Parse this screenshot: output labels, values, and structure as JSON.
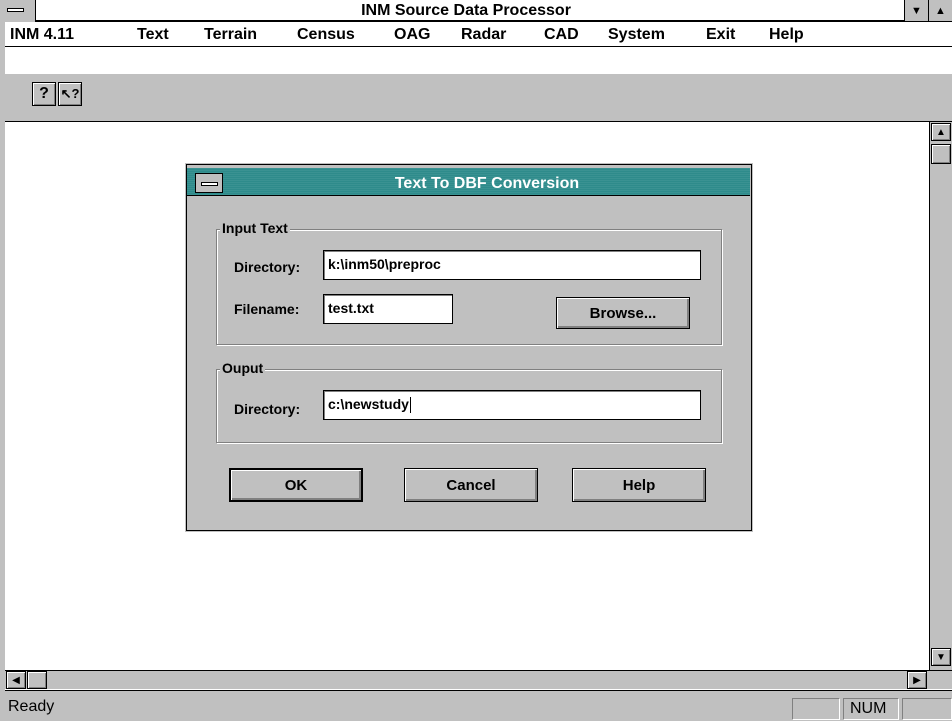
{
  "window": {
    "title": "INM Source Data Processor"
  },
  "menubar": {
    "items": [
      {
        "label": "INM 4.11"
      },
      {
        "label": "Text"
      },
      {
        "label": "Terrain"
      },
      {
        "label": "Census"
      },
      {
        "label": "OAG"
      },
      {
        "label": "Radar"
      },
      {
        "label": "CAD"
      },
      {
        "label": "System"
      },
      {
        "label": "Exit"
      },
      {
        "label": "Help"
      }
    ]
  },
  "toolbar": {
    "help_icon": "?",
    "context_help_icon": "?"
  },
  "dialog": {
    "title": "Text To DBF Conversion",
    "input_group": {
      "label": "Input Text",
      "directory_label": "Directory:",
      "directory_value": "k:\\inm50\\preproc",
      "filename_label": "Filename:",
      "filename_value": "test.txt",
      "browse_label": "Browse..."
    },
    "output_group": {
      "label": "Ouput",
      "directory_label": "Directory:",
      "directory_value": "c:\\newstudy"
    },
    "buttons": {
      "ok": "OK",
      "cancel": "Cancel",
      "help": "Help"
    }
  },
  "statusbar": {
    "text": "Ready",
    "num": "NUM"
  }
}
